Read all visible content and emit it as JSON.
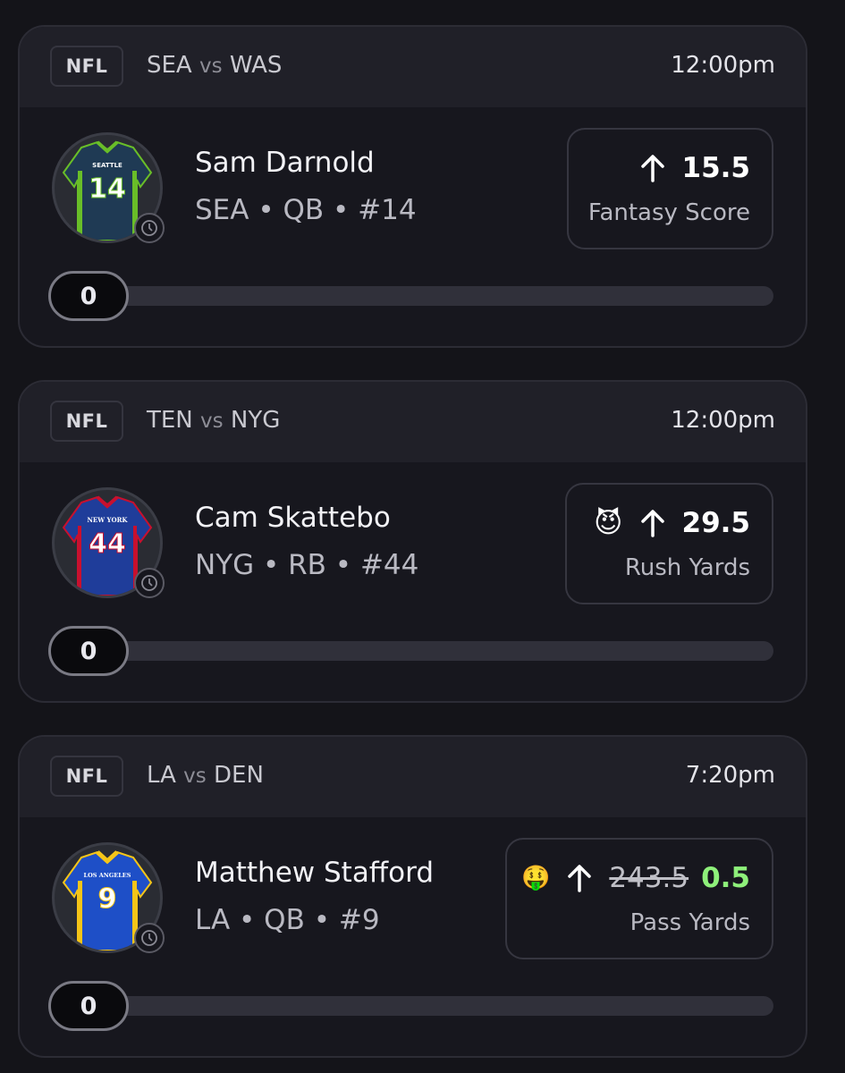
{
  "cards": [
    {
      "league": "NFL",
      "team_a": "SEA",
      "vs": "vs",
      "team_b": "WAS",
      "time": "12:00pm",
      "player_name": "Sam Darnold",
      "player_meta": "SEA • QB • #14",
      "jersey": {
        "city": "SEATTLE",
        "number": "14",
        "body": "#1f3a54",
        "trim": "#69be28"
      },
      "direction_icon": "arrow-up-icon",
      "line": "15.5",
      "stat": "Fantasy Score",
      "progress_value": "0"
    },
    {
      "league": "NFL",
      "team_a": "TEN",
      "vs": "vs",
      "team_b": "NYG",
      "time": "12:00pm",
      "player_name": "Cam Skattebo",
      "player_meta": "NYG • RB • #44",
      "jersey": {
        "city": "NEW YORK",
        "number": "44",
        "body": "#1f3d9a",
        "trim": "#c8102e"
      },
      "badge_icon": "devil-emoji-icon",
      "badge_emoji": "😈",
      "direction_icon": "arrow-up-icon",
      "line": "29.5",
      "stat": "Rush Yards",
      "progress_value": "0"
    },
    {
      "league": "NFL",
      "team_a": "LA",
      "vs": "vs",
      "team_b": "DEN",
      "time": "7:20pm",
      "player_name": "Matthew Stafford",
      "player_meta": "LA • QB • #9",
      "jersey": {
        "city": "LOS ANGELES",
        "number": "9",
        "body": "#1e4fc7",
        "trim": "#f5c518"
      },
      "badge_icon": "money-mouth-emoji-icon",
      "badge_emoji": "🤑",
      "direction_icon": "arrow-up-icon",
      "old_line": "243.5",
      "line": "0.5",
      "stat": "Pass Yards",
      "progress_value": "0"
    }
  ],
  "colors": {
    "background": "#141419",
    "card": "#17171e",
    "header": "#202028",
    "promo_green": "#8ef07a"
  }
}
